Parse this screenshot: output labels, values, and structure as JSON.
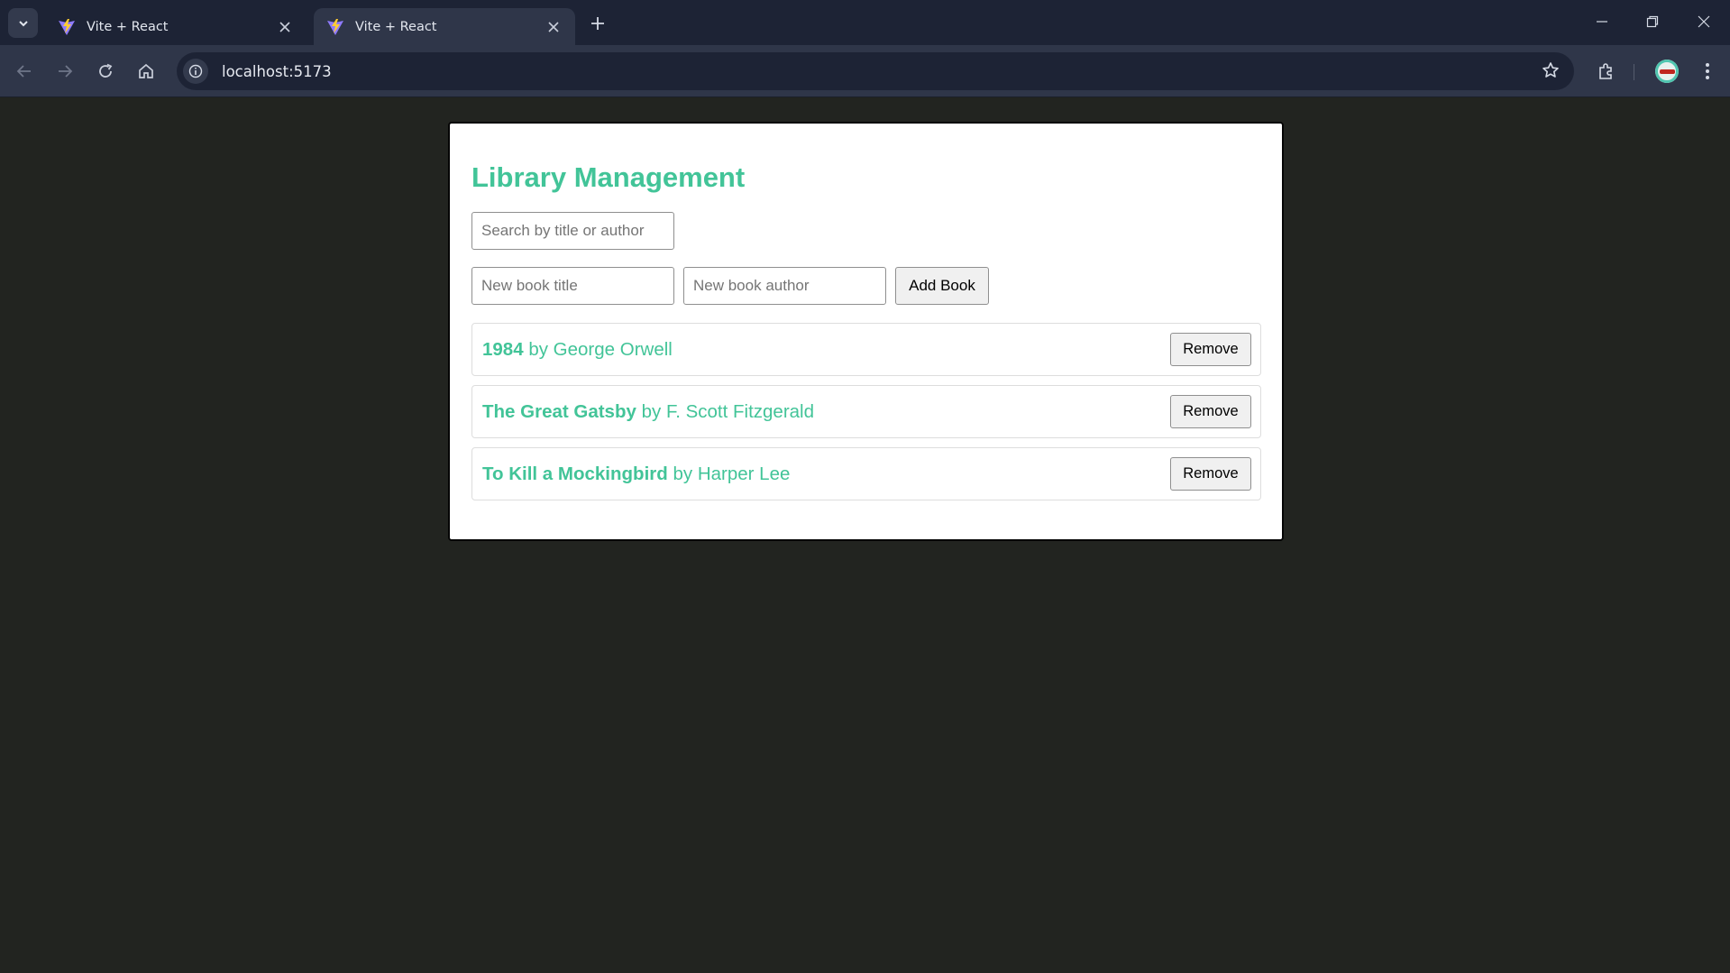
{
  "browser": {
    "tabs": [
      {
        "title": "Vite + React",
        "active": false
      },
      {
        "title": "Vite + React",
        "active": true
      }
    ],
    "url": "localhost:5173"
  },
  "app": {
    "title": "Library Management",
    "search_placeholder": "Search by title or author",
    "new_title_placeholder": "New book title",
    "new_author_placeholder": "New book author",
    "add_button": "Add Book",
    "remove_label": "Remove",
    "books": [
      {
        "title": "1984",
        "by": "by",
        "author": "George Orwell"
      },
      {
        "title": "The Great Gatsby",
        "by": "by",
        "author": "F. Scott Fitzgerald"
      },
      {
        "title": "To Kill a Mockingbird",
        "by": "by",
        "author": "Harper Lee"
      }
    ]
  },
  "colors": {
    "accent": "#42c498",
    "page_background": "#222420",
    "chrome_dark": "#1d2335",
    "chrome_toolbar": "#2f3649"
  },
  "icons": [
    "tab-search-icon",
    "vite-favicon-icon",
    "close-icon",
    "plus-icon",
    "minimize-icon",
    "restore-icon",
    "back-icon",
    "forward-icon",
    "reload-icon",
    "home-icon",
    "site-info-icon",
    "bookmark-star-icon",
    "extensions-icon",
    "profile-avatar-icon",
    "more-menu-icon"
  ]
}
